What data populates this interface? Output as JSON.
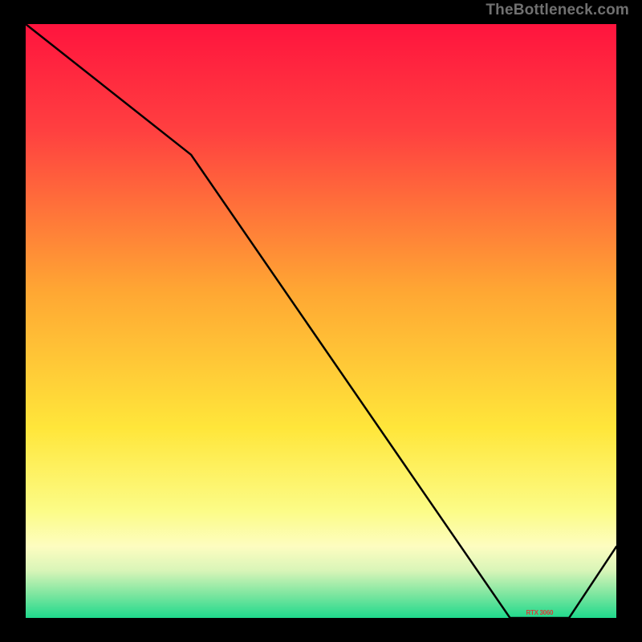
{
  "attribution": "TheBottleneck.com",
  "chart_data": {
    "type": "line",
    "title": "",
    "xlabel": "",
    "ylabel": "",
    "x": [
      0.0,
      0.28,
      0.82,
      0.92,
      1.0
    ],
    "values": [
      1.0,
      0.78,
      0.0,
      0.0,
      0.12
    ],
    "xlim": [
      0,
      1
    ],
    "ylim": [
      0,
      1
    ]
  },
  "x_label_text": "RTX 3060"
}
